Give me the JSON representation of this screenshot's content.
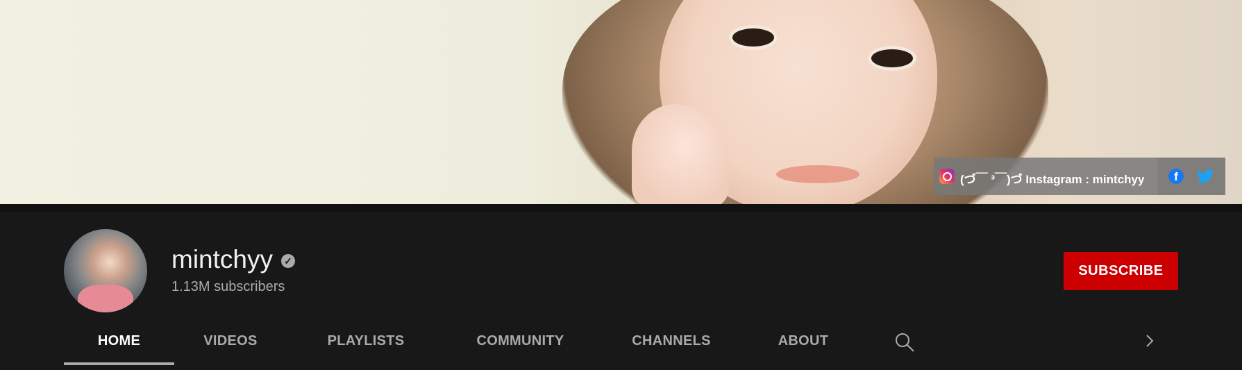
{
  "banner": {
    "link_text": "(づ￣ ³￣)づ Instagram : mintchyy",
    "icons": [
      "instagram-icon",
      "facebook-icon",
      "twitter-icon"
    ]
  },
  "channel": {
    "name": "mintchyy",
    "subscribers": "1.13M subscribers",
    "subscribe_label": "SUBSCRIBE"
  },
  "tabs": [
    {
      "label": "HOME",
      "active": true
    },
    {
      "label": "VIDEOS"
    },
    {
      "label": "PLAYLISTS"
    },
    {
      "label": "COMMUNITY"
    },
    {
      "label": "CHANNELS"
    },
    {
      "label": "ABOUT"
    }
  ],
  "colors": {
    "background": "#181818",
    "subscribe": "#cc0000",
    "text": "#f1f1f1",
    "muted": "#aaaaaa"
  }
}
